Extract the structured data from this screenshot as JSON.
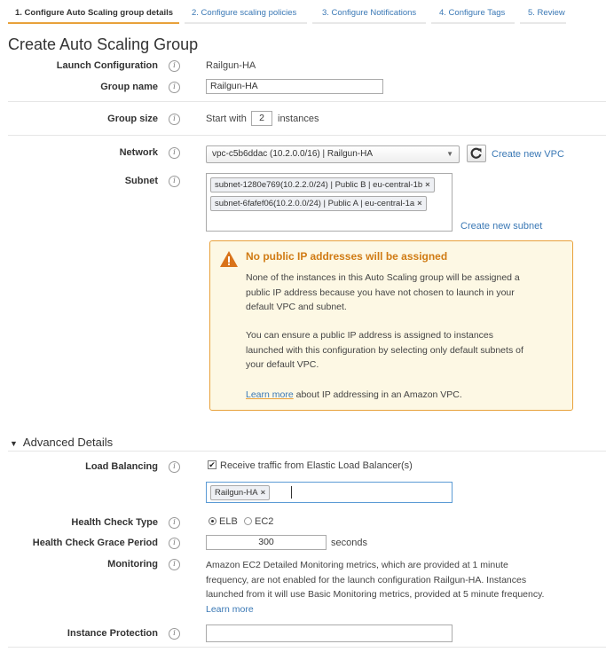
{
  "steps": [
    {
      "label": "1. Configure Auto Scaling group details",
      "active": true
    },
    {
      "label": "2. Configure scaling policies",
      "active": false
    },
    {
      "label": "3. Configure Notifications",
      "active": false
    },
    {
      "label": "4. Configure Tags",
      "active": false
    },
    {
      "label": "5. Review",
      "active": false
    }
  ],
  "page_title": "Create Auto Scaling Group",
  "info_glyph": "i",
  "launch_config": {
    "label": "Launch Configuration",
    "value": "Railgun-HA"
  },
  "group_name": {
    "label": "Group name",
    "value": "Railgun-HA"
  },
  "group_size": {
    "label": "Group size",
    "prefix": "Start with",
    "value": "2",
    "suffix": "instances"
  },
  "network": {
    "label": "Network",
    "selected": "vpc-c5b6ddac (10.2.0.0/16) | Railgun-HA",
    "refresh_icon": "refresh-icon",
    "create_link": "Create new VPC"
  },
  "subnet": {
    "label": "Subnet",
    "tags": [
      "subnet-1280e769(10.2.2.0/24) | Public B | eu-central-1b",
      "subnet-6fafef06(10.2.0.0/24) | Public A | eu-central-1a"
    ],
    "create_link": "Create new subnet"
  },
  "warning": {
    "icon": "warning-icon",
    "title": "No public IP addresses will be assigned",
    "para1_line1": "None of the instances in this Auto Scaling group will be assigned a",
    "para1_line2": "public IP address because you have not chosen to launch in your",
    "para1_line3": "default VPC and subnet.",
    "para2_line1": "You can ensure a public IP address is assigned to instances",
    "para2_line2": "launched with this configuration by selecting only default subnets of",
    "para2_line3": "your default VPC.",
    "learn_more": "Learn more",
    "learn_more_suffix": "about IP addressing in an Amazon VPC."
  },
  "advanced": {
    "title": "Advanced Details",
    "toggle_icon": "triangle-down-icon"
  },
  "load_balancing": {
    "label": "Load Balancing",
    "checkbox_label": "Receive traffic from Elastic Load Balancer(s)",
    "checked": true,
    "tags": [
      "Railgun-HA"
    ]
  },
  "health_check_type": {
    "label": "Health Check Type",
    "options": [
      "ELB",
      "EC2"
    ],
    "selected": "ELB"
  },
  "grace_period": {
    "label": "Health Check Grace Period",
    "value": "300",
    "suffix": "seconds"
  },
  "monitoring": {
    "label": "Monitoring",
    "line1": "Amazon EC2 Detailed Monitoring metrics, which are provided at 1 minute",
    "line2": "frequency, are not enabled for the launch configuration Railgun-HA. Instances",
    "line3": "launched from it will use Basic Monitoring metrics, provided at 5 minute frequency.",
    "learn_more": "Learn more"
  },
  "instance_protection": {
    "label": "Instance Protection",
    "value": ""
  },
  "colors": {
    "accent": "#e8a13b",
    "link": "#3a78b5",
    "warning_bg": "#fdf8e4",
    "warning_title": "#d07b14"
  }
}
